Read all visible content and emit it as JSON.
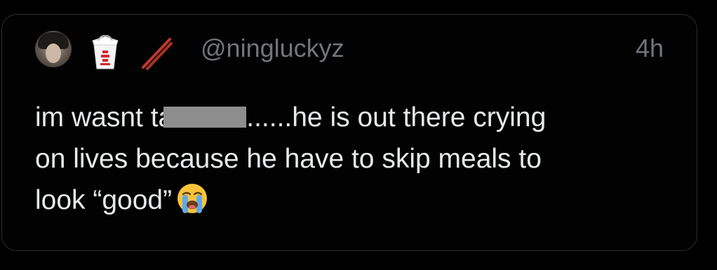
{
  "tweet": {
    "username": "@ningluckyz",
    "time": "4h",
    "line1_before": "im wasnt ta",
    "line1_after": "......he is out there crying",
    "line2": "on lives because he have to skip meals to",
    "line3": "look “good”"
  },
  "icons": {
    "avatar": "profile-photo",
    "emoji_1": "takeout-box-icon",
    "emoji_2": "chopsticks-icon",
    "emoji_3": "loudly-crying-face-icon"
  }
}
